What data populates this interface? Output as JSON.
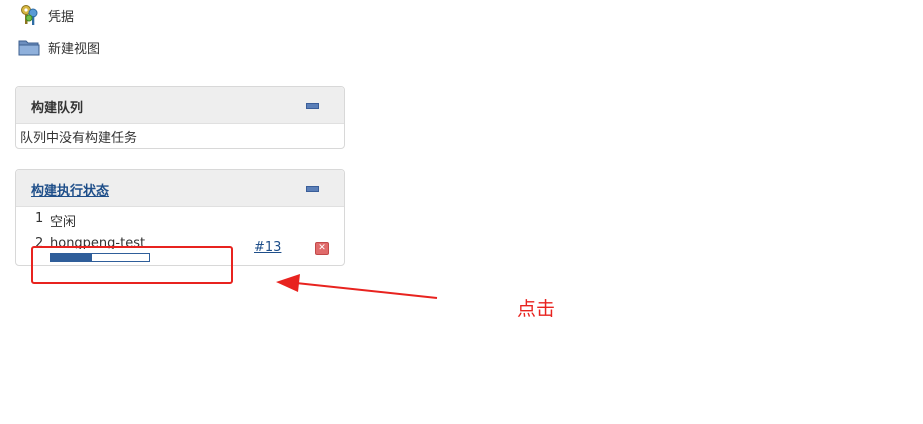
{
  "nav": {
    "credentials_label": "凭据",
    "credentials_icon": "keys-icon",
    "new_view_label": "新建视图",
    "new_view_icon": "folder-icon"
  },
  "queue_panel": {
    "title": "构建队列",
    "empty_message": "队列中没有构建任务"
  },
  "executor_panel": {
    "title": "构建执行状态",
    "executors": [
      {
        "number": "1",
        "status": "空闲"
      },
      {
        "number": "2",
        "job": "hongpeng-test",
        "build": "#13",
        "progress": 0.42
      }
    ]
  },
  "annotation": {
    "text": "点击",
    "color": "#e8231f"
  }
}
